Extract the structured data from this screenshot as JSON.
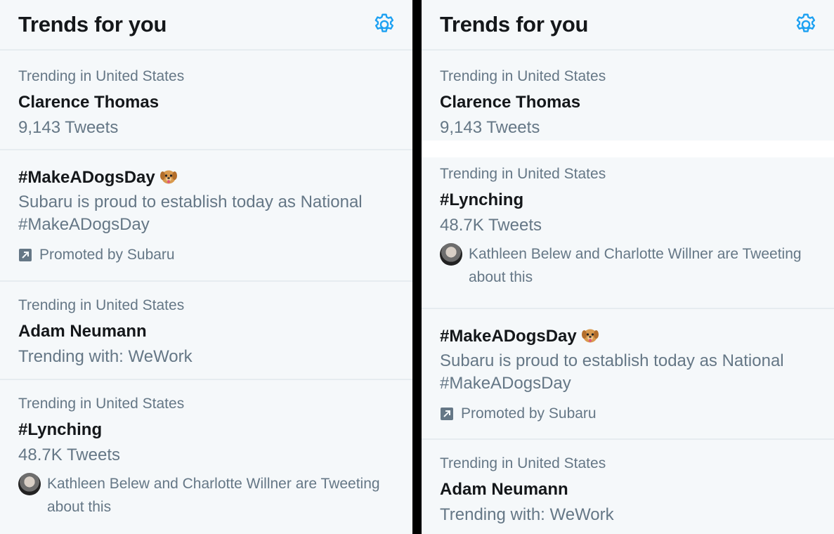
{
  "panels": [
    {
      "header_title": "Trends for you",
      "trends": [
        {
          "context": "Trending in United States",
          "name": "Clarence Thomas",
          "meta": "9,143 Tweets"
        },
        {
          "name": "#MakeADogsDay",
          "description": "Subaru is proud to establish today as National #MakeADogsDay",
          "promoted": "Promoted by Subaru"
        },
        {
          "context": "Trending in United States",
          "name": "Adam Neumann",
          "meta": "Trending with: WeWork"
        },
        {
          "context": "Trending in United States",
          "name": "#Lynching",
          "meta": "48.7K Tweets",
          "tweeting": "Kathleen Belew and Charlotte Willner are Tweeting about this"
        }
      ]
    },
    {
      "header_title": "Trends for you",
      "trends": [
        {
          "context": "Trending in United States",
          "name": "Clarence Thomas",
          "meta": "9,143 Tweets"
        },
        {
          "context": "Trending in United States",
          "name": "#Lynching",
          "meta": "48.7K Tweets",
          "tweeting": "Kathleen Belew and Charlotte Willner are Tweeting about this"
        },
        {
          "name": "#MakeADogsDay",
          "description": "Subaru is proud to establish today as National #MakeADogsDay",
          "promoted": "Promoted by Subaru"
        },
        {
          "context": "Trending in United States",
          "name": "Adam Neumann",
          "meta": "Trending with: WeWork"
        }
      ]
    }
  ],
  "icons": {
    "settings": "gear-icon",
    "promoted": "promoted-arrow-icon",
    "emoji": "dog-face-emoji-icon"
  },
  "colors": {
    "accent": "#1da1f2",
    "text_primary": "#14171a",
    "text_secondary": "#657786",
    "background": "#f5f8fa",
    "divider": "#e6ecf0"
  }
}
